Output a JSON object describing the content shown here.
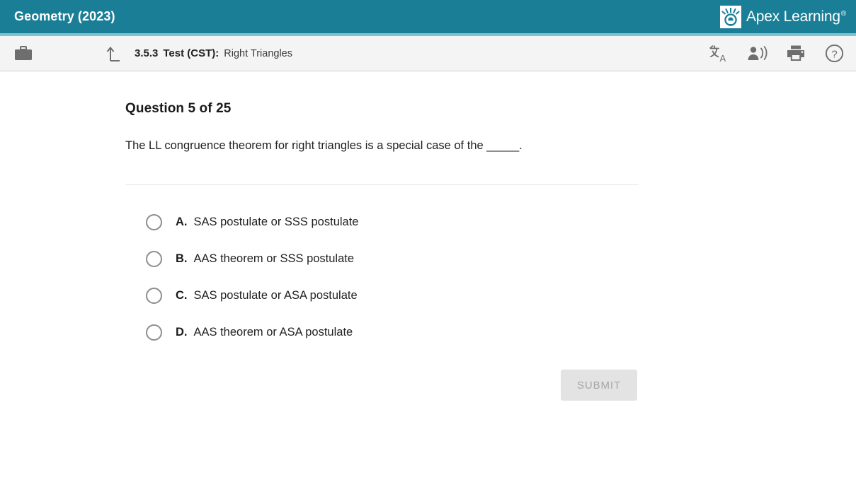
{
  "header": {
    "course_title": "Geometry (2023)",
    "brand_name": "Apex Learning",
    "brand_tm": "®",
    "brand_logo_icon": "apex-sunburst-logo-icon",
    "bg_color": "#1a7e96"
  },
  "toolbar": {
    "briefcase_icon": "briefcase-icon",
    "uplevel_icon": "up-level-arrow-icon",
    "breadcrumb": {
      "number": "3.5.3",
      "type": "Test (CST):",
      "name": "Right Triangles"
    },
    "actions": [
      {
        "icon": "translate-icon",
        "name": "translate-button"
      },
      {
        "icon": "read-aloud-icon",
        "name": "read-aloud-button"
      },
      {
        "icon": "printer-icon",
        "name": "print-button"
      },
      {
        "icon": "help-icon",
        "name": "help-button"
      }
    ]
  },
  "question": {
    "header": "Question 5 of 25",
    "number": 5,
    "total": 25,
    "text": "The LL congruence theorem for right triangles is a special case of the _____.",
    "options": [
      {
        "letter": "A.",
        "text": "SAS postulate or SSS postulate",
        "selected": false
      },
      {
        "letter": "B.",
        "text": "AAS theorem or SSS postulate",
        "selected": false
      },
      {
        "letter": "C.",
        "text": "SAS postulate or ASA postulate",
        "selected": false
      },
      {
        "letter": "D.",
        "text": "AAS theorem or ASA postulate",
        "selected": false
      }
    ]
  },
  "submit": {
    "label": "SUBMIT",
    "disabled": true
  }
}
